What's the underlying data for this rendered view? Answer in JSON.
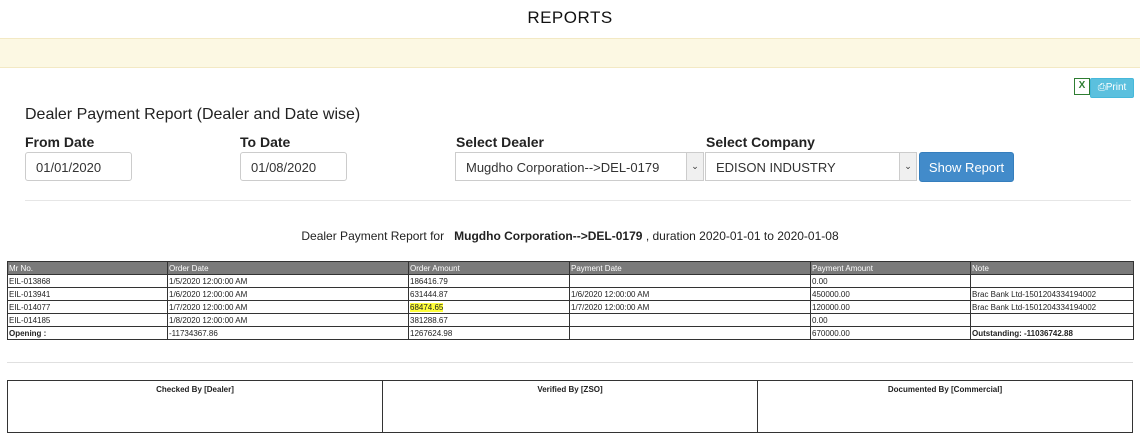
{
  "page": {
    "title": "REPORTS"
  },
  "toolbar": {
    "excel_icon": "excel-icon",
    "print_label": "Print"
  },
  "form": {
    "heading": "Dealer Payment Report (Dealer and Date wise)",
    "from_date_label": "From Date",
    "from_date_value": "01/01/2020",
    "to_date_label": "To Date",
    "to_date_value": "01/08/2020",
    "dealer_label": "Select Dealer",
    "dealer_value": "Mugdho Corporation-->DEL-0179",
    "company_label": "Select Company",
    "company_value": "EDISON INDUSTRY",
    "show_button": "Show Report"
  },
  "report": {
    "caption_prefix": "Dealer Payment Report for",
    "dealer": "Mugdho Corporation-->DEL-0179",
    "caption_suffix": ", duration 2020-01-01 to 2020-01-08",
    "columns": [
      "Mr No.",
      "Order Date",
      "Order Amount",
      "Payment Date",
      "Payment Amount",
      "Note"
    ],
    "rows": [
      [
        "EIL-013868",
        "1/5/2020 12:00:00 AM",
        "186416.79",
        "",
        "0.00",
        ""
      ],
      [
        "EIL-013941",
        "1/6/2020 12:00:00 AM",
        "631444.87",
        "1/6/2020 12:00:00 AM",
        "450000.00",
        "Brac Bank Ltd-1501204334194002"
      ],
      [
        "EIL-014077",
        "1/7/2020 12:00:00 AM",
        "68474.65",
        "1/7/2020 12:00:00 AM",
        "120000.00",
        "Brac Bank Ltd-1501204334194002"
      ],
      [
        "EIL-014185",
        "1/8/2020 12:00:00 AM",
        "381288.67",
        "",
        "0.00",
        ""
      ]
    ],
    "opening": {
      "label": "Opening :",
      "order_date": "-11734367.86",
      "order_amount": "1267624.98",
      "payment_date": "",
      "payment_amount": "670000.00",
      "note": "Outstanding: -11036742.88"
    }
  },
  "signatures": {
    "checked": "Checked By [Dealer]",
    "verified": "Verified By [ZSO]",
    "documented": "Documented By [Commercial]"
  },
  "colors": {
    "alert_bg": "#fcf8e3",
    "primary": "#428bca",
    "info": "#5bc0de",
    "header_bg": "#7a7a7a",
    "highlight": "#ffff3a"
  }
}
